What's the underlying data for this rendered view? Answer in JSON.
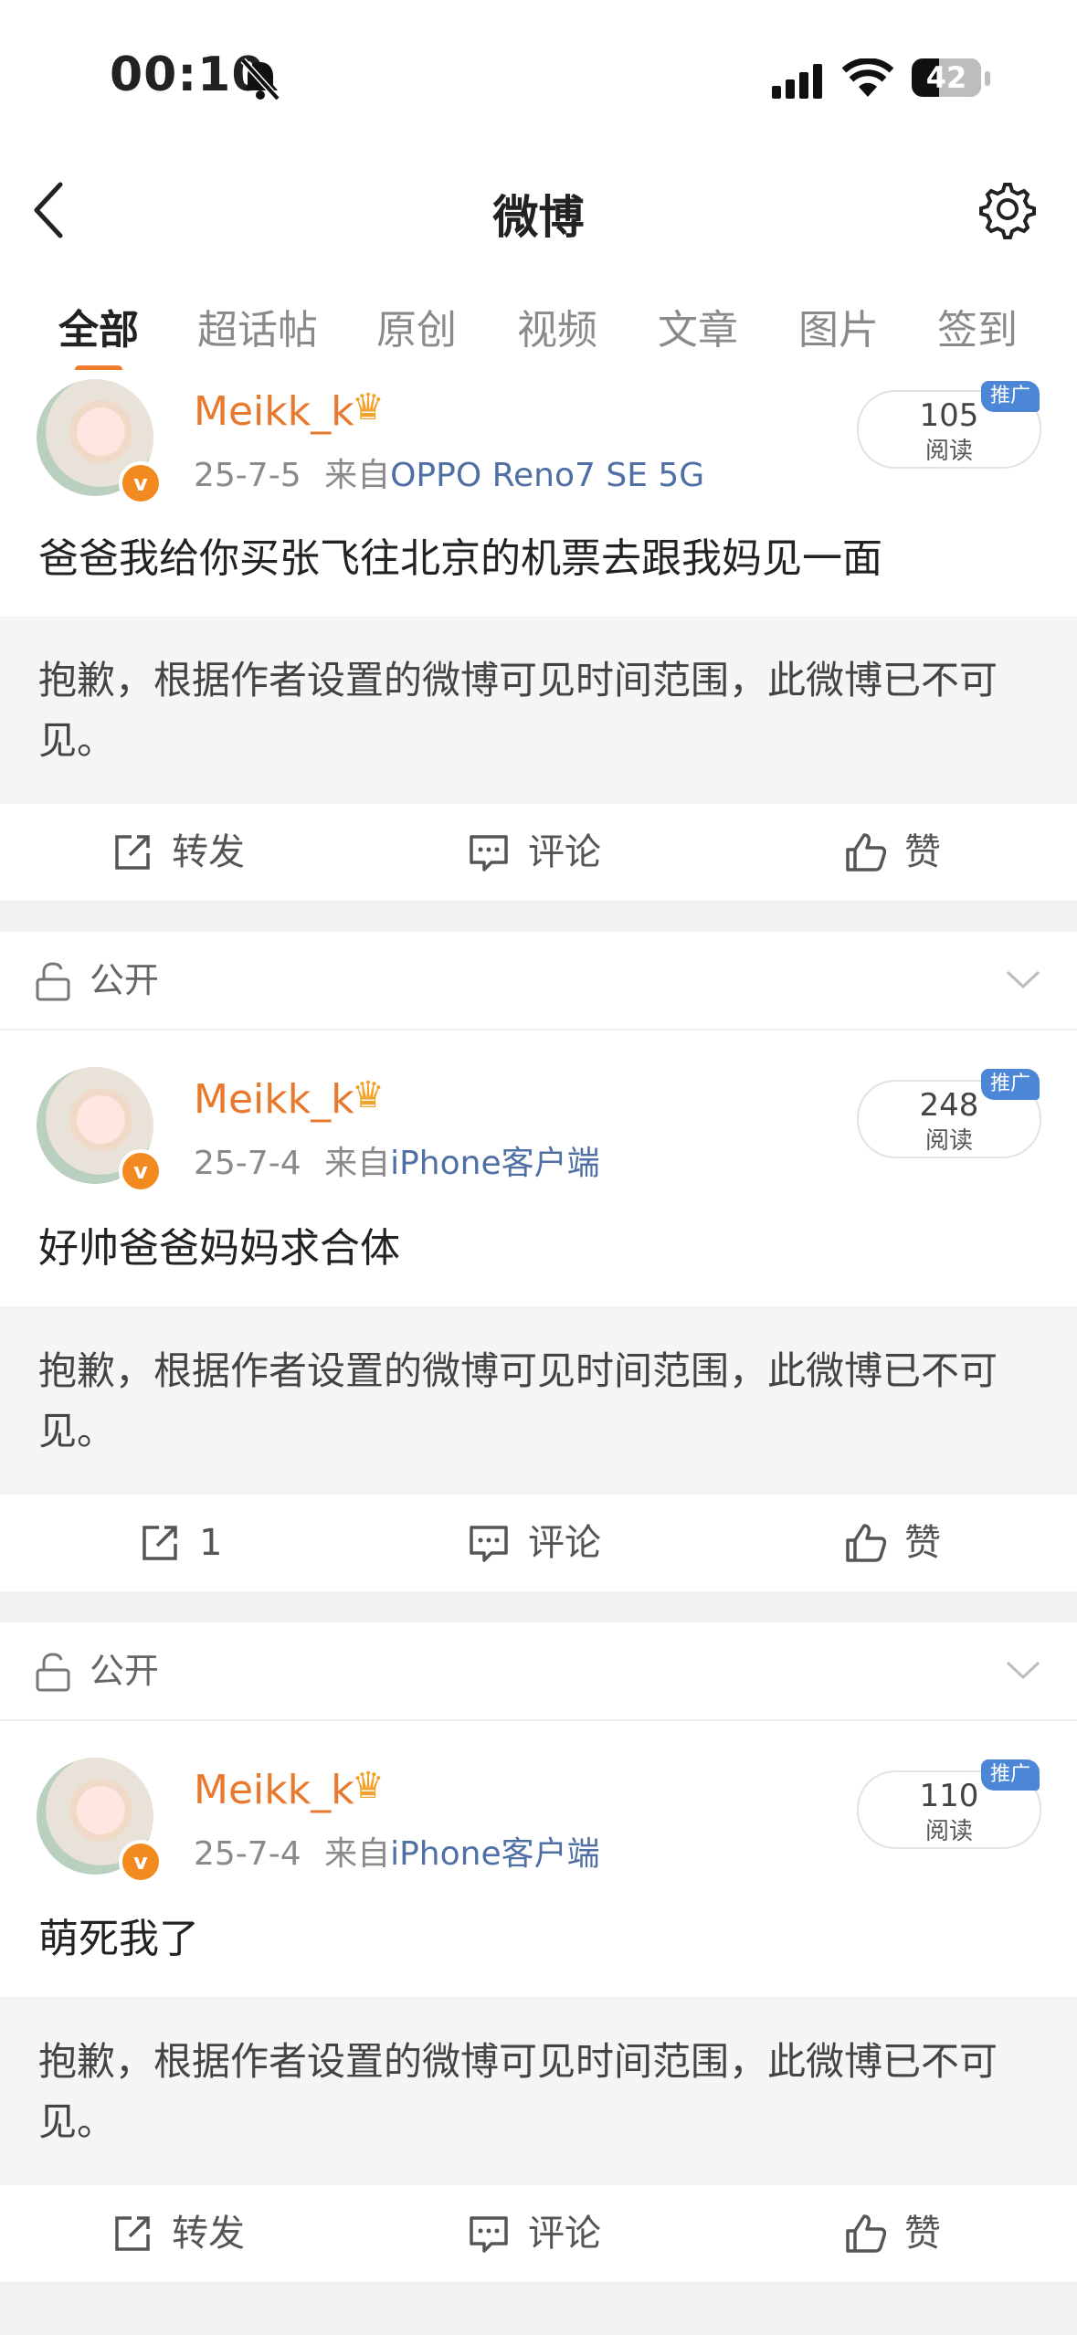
{
  "status_bar": {
    "time": "00:10",
    "battery": "42"
  },
  "nav": {
    "title": "微博"
  },
  "tabs": [
    "全部",
    "超话帖",
    "原创",
    "视频",
    "文章",
    "图片",
    "签到"
  ],
  "posts": [
    {
      "username": "Meikk_k",
      "date": "25-7-5",
      "source_prefix": "来自",
      "source": "OPPO Reno7 SE 5G",
      "reads": "105",
      "reads_label": "阅读",
      "promo": "推广",
      "text": "爸爸我给你买张飞往北京的机票去跟我妈见一面",
      "hidden_notice": "抱歉，根据作者设置的微博可见时间范围，此微博已不可见。",
      "repost_label": "转发",
      "comment_label": "评论",
      "like_label": "赞"
    },
    {
      "visibility": "公开",
      "username": "Meikk_k",
      "date": "25-7-4",
      "source_prefix": "来自",
      "source": "iPhone客户端",
      "reads": "248",
      "reads_label": "阅读",
      "promo": "推广",
      "text": "好帅爸爸妈妈求合体",
      "hidden_notice": "抱歉，根据作者设置的微博可见时间范围，此微博已不可见。",
      "repost_label": "1",
      "comment_label": "评论",
      "like_label": "赞"
    },
    {
      "visibility": "公开",
      "username": "Meikk_k",
      "date": "25-7-4",
      "source_prefix": "来自",
      "source": "iPhone客户端",
      "reads": "110",
      "reads_label": "阅读",
      "promo": "推广",
      "text": "萌死我了",
      "hidden_notice": "抱歉，根据作者设置的微博可见时间范围，此微博已不可见。",
      "repost_label": "转发",
      "comment_label": "评论",
      "like_label": "赞"
    }
  ],
  "colors": {
    "accent": "#f07a2e",
    "username": "#e8782c",
    "source": "#4f6fa5",
    "promo": "#4c86d6"
  }
}
